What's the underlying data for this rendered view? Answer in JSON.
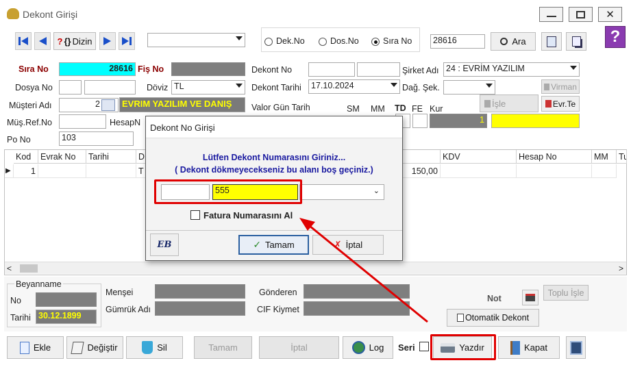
{
  "window": {
    "title": "Dekont Girişi",
    "minimize": "—",
    "maximize": "▢",
    "close": "✕"
  },
  "toolbar": {
    "dizin": "Dizin",
    "help_mark": "?",
    "search_combo_value": "",
    "radio_dekno": "Dek.No",
    "radio_dosno": "Dos.No",
    "radio_sirano": "Sıra No",
    "selected_radio": "Sıra No",
    "search_value": "28616",
    "ara": "Ara"
  },
  "left": {
    "sira_no_label": "Sıra No",
    "sira_no_value": "28616",
    "fis_no_label": "Fiş No",
    "dosya_no_label": "Dosya No",
    "doviz_label": "Döviz",
    "doviz_value": "TL",
    "musteri_adi_label": "Müşteri Adı",
    "musteri_code": "2",
    "musteri_name": "EVRIM YAZILIM VE DANIŞ",
    "mus_ref_label": "Müş.Ref.No",
    "hesap_label": "HesapN",
    "po_no_label": "Po No",
    "po_no_value": "103"
  },
  "right": {
    "dekont_no_label": "Dekont No",
    "sirket_adi_label": "Şirket Adı",
    "sirket_adi_value": "24 : EVRİM YAZILIM",
    "dekont_tarihi_label": "Dekont Tarihi",
    "dekont_tarihi_value": "17.10.2024",
    "dag_sek_label": "Dağ. Şek.",
    "virman": "Virman",
    "isle": "İşle",
    "evr_te": "Evr.Te",
    "valor_label": "Valor Gün Tarih",
    "sm": "SM",
    "mm": "MM",
    "td": "TD",
    "fe": "FE",
    "kur": "Kur",
    "kur_value": "1"
  },
  "grid": {
    "headers": [
      "Kod",
      "Evrak No",
      "Tarihi",
      "D",
      "KDV",
      "Hesap No",
      "MM",
      "Tu"
    ],
    "rows": [
      {
        "marker": "▶",
        "kod": "1",
        "evrak_no": "",
        "tarihi": "",
        "d": "T",
        "amount": "150,00",
        "kdv": "",
        "hesap_no": "",
        "mm": ""
      }
    ]
  },
  "bottom": {
    "beyanname": "Beyanname",
    "no_label": "No",
    "tarihi_label": "Tarihi",
    "tarihi_value": "30.12.1899",
    "mensei_label": "Menşei",
    "gumruk_label": "Gümrük Adı",
    "gonderen_label": "Gönderen",
    "cif_label": "CIF Kiymet",
    "not_label": "Not",
    "toplu_isle": "Toplu İşle",
    "otomatik_dekont": "Otomatik Dekont"
  },
  "buttons": {
    "ekle": "Ekle",
    "degistir": "Değiştir",
    "sil": "Sil",
    "tamam": "Tamam",
    "iptal": "İptal",
    "log": "Log",
    "seri": "Seri",
    "yazdir": "Yazdır",
    "kapat": "Kapat"
  },
  "dialog": {
    "title": "Dekont No Girişi",
    "line1": "Lütfen Dekont Numarasını Giriniz...",
    "line2": "( Dekont dökmeyecekseniz bu alanı boş geçiniz.)",
    "input1": "",
    "input2": "555",
    "checkbox_label": "Fatura Numarasını Al",
    "tamam": "Tamam",
    "iptal": "İptal",
    "logo": "EB"
  },
  "colors": {
    "highlight": "#e00000",
    "yellow": "#ffff00",
    "cyan": "#00ffff",
    "label_red": "#8b0000",
    "dialog_text": "#1a1aa0"
  }
}
